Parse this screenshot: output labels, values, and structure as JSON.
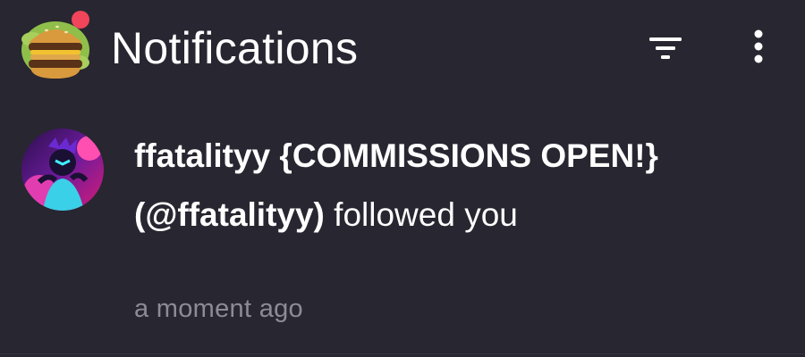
{
  "header": {
    "title": "Notifications",
    "app_avatar_icon": "burger-avatar-icon",
    "notification_dot_color": "#f0455a",
    "filter_icon": "filter-icon",
    "more_icon": "more-vertical-icon"
  },
  "notifications": [
    {
      "display_name": "ffatalityy {COMMISSIONS OPEN!}",
      "handle": "(@ffatalityy)",
      "action": "followed you",
      "time": "a moment ago",
      "avatar_icon": "user-avatar-icon"
    }
  ],
  "colors": {
    "background": "#282630",
    "text_primary": "#ffffff",
    "text_secondary": "#8d8b96"
  }
}
